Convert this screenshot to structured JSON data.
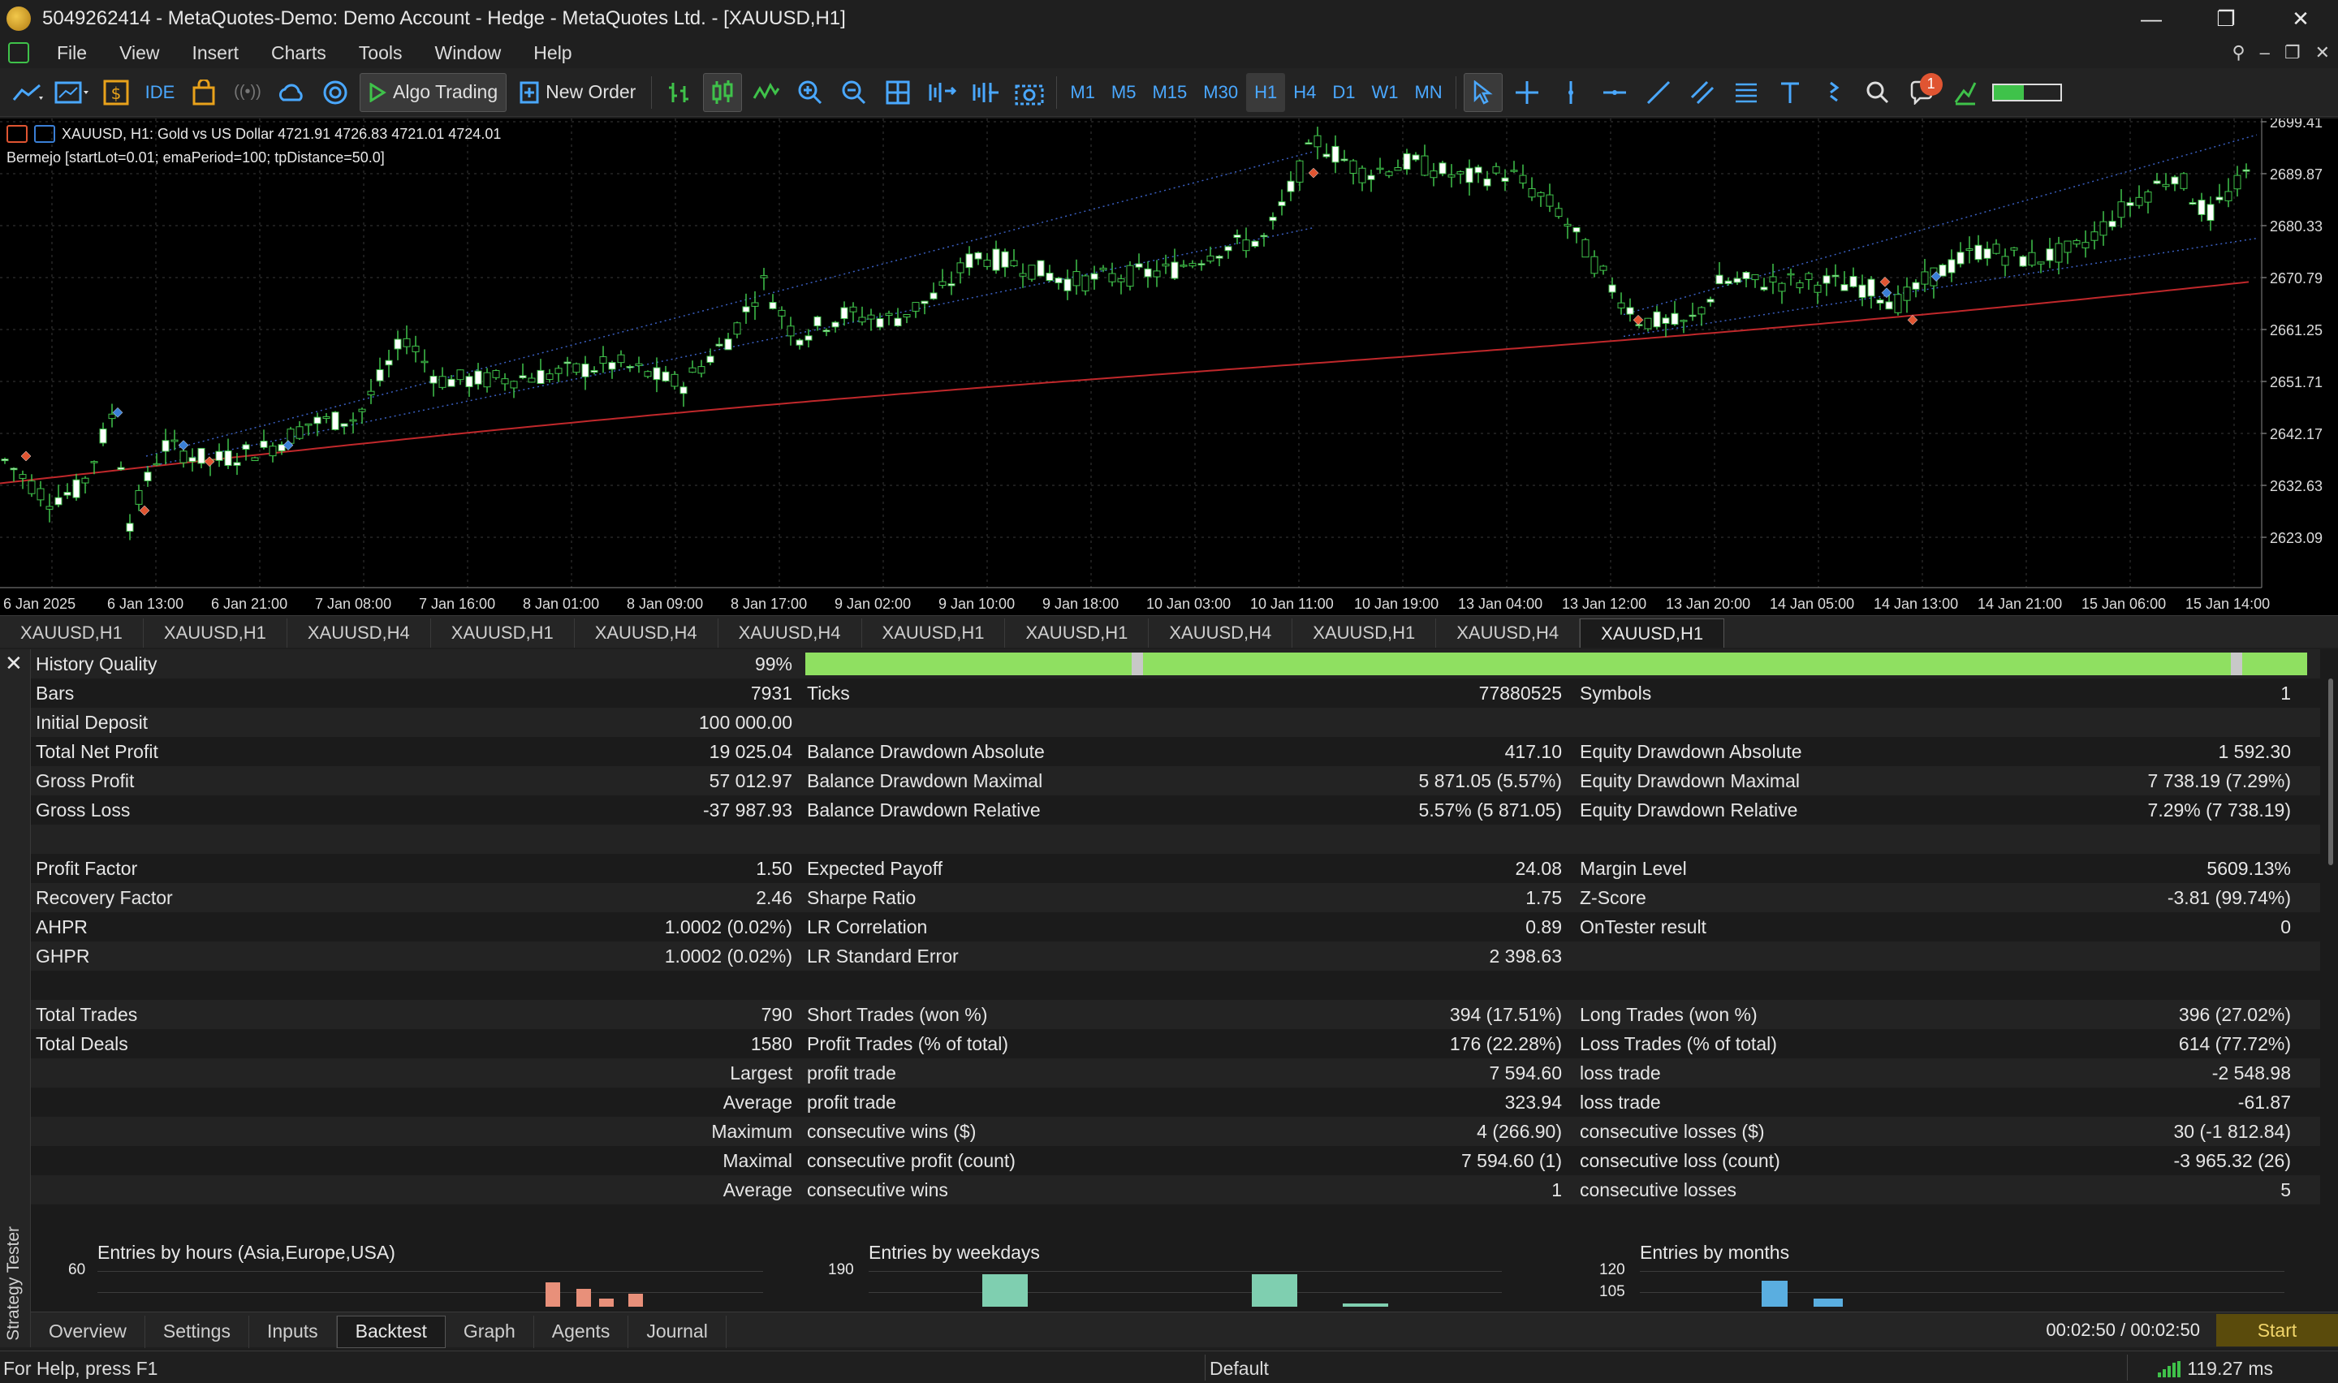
{
  "window": {
    "title": "5049262414 - MetaQuotes-Demo: Demo Account - Hedge - MetaQuotes Ltd. - [XAUUSD,H1]",
    "controls": [
      "—",
      "❐",
      "✕"
    ]
  },
  "menu": {
    "items": [
      "File",
      "View",
      "Insert",
      "Charts",
      "Tools",
      "Window",
      "Help"
    ]
  },
  "toolbar": {
    "ide_label": "IDE",
    "algo_trading_label": "Algo Trading",
    "new_order_label": "New Order",
    "timeframes": [
      "M1",
      "M5",
      "M15",
      "M30",
      "H1",
      "H4",
      "D1",
      "W1",
      "MN"
    ],
    "selected_timeframe": "H1",
    "notification_count": "1",
    "level_fill": 0.45
  },
  "chart": {
    "symbol_info": "XAUUSD, H1:  Gold vs US Dollar  4721.91 4726.83 4721.01 4724.01",
    "expert_info": "Bermejo [startLot=0.01; emaPeriod=100; tpDistance=50.0]",
    "price_ticks": [
      "2699.41",
      "2689.87",
      "2680.33",
      "2670.79",
      "2661.25",
      "2651.71",
      "2642.17",
      "2632.63",
      "2623.09"
    ],
    "time_ticks": [
      "6 Jan 2025",
      "6 Jan 13:00",
      "6 Jan 21:00",
      "7 Jan 08:00",
      "7 Jan 16:00",
      "8 Jan 01:00",
      "8 Jan 09:00",
      "8 Jan 17:00",
      "9 Jan 02:00",
      "9 Jan 10:00",
      "9 Jan 18:00",
      "10 Jan 03:00",
      "10 Jan 11:00",
      "10 Jan 19:00",
      "13 Jan 04:00",
      "13 Jan 12:00",
      "13 Jan 20:00",
      "14 Jan 05:00",
      "14 Jan 13:00",
      "14 Jan 21:00",
      "15 Jan 06:00",
      "15 Jan 14:00"
    ],
    "colors": {
      "background": "#000000",
      "grid": "#3a3a3a",
      "ema": "#c0282b",
      "bull": "#ffffff",
      "bear": "#000000",
      "wick": "#3fc24a",
      "buy_marker": "#3a7fd6",
      "sell_marker": "#e05532"
    }
  },
  "symbol_tabs": [
    "XAUUSD,H1",
    "XAUUSD,H1",
    "XAUUSD,H4",
    "XAUUSD,H1",
    "XAUUSD,H4",
    "XAUUSD,H4",
    "XAUUSD,H1",
    "XAUUSD,H1",
    "XAUUSD,H4",
    "XAUUSD,H1",
    "XAUUSD,H4",
    "XAUUSD,H1"
  ],
  "active_symbol_tab": 11,
  "tester": {
    "sidebar_label": "Strategy Tester",
    "history_quality": {
      "label": "History Quality",
      "value": "99%"
    },
    "rows": [
      {
        "c1": [
          "Bars",
          "7931"
        ],
        "c2": [
          "Ticks",
          "77880525"
        ],
        "c3": [
          "Symbols",
          "1"
        ]
      },
      {
        "c1": [
          "Initial Deposit",
          "100 000.00"
        ],
        "c2": [
          "",
          ""
        ],
        "c3": [
          "",
          ""
        ]
      },
      {
        "c1": [
          "Total Net Profit",
          "19 025.04"
        ],
        "c2": [
          "Balance Drawdown Absolute",
          "417.10"
        ],
        "c3": [
          "Equity Drawdown Absolute",
          "1 592.30"
        ]
      },
      {
        "c1": [
          "Gross Profit",
          "57 012.97"
        ],
        "c2": [
          "Balance Drawdown Maximal",
          "5 871.05 (5.57%)"
        ],
        "c3": [
          "Equity Drawdown Maximal",
          "7 738.19 (7.29%)"
        ]
      },
      {
        "c1": [
          "Gross Loss",
          "-37 987.93"
        ],
        "c2": [
          "Balance Drawdown Relative",
          "5.57% (5 871.05)"
        ],
        "c3": [
          "Equity Drawdown Relative",
          "7.29% (7 738.19)"
        ]
      },
      {
        "c1": [
          "",
          ""
        ],
        "c2": [
          "",
          ""
        ],
        "c3": [
          "",
          ""
        ]
      },
      {
        "c1": [
          "Profit Factor",
          "1.50"
        ],
        "c2": [
          "Expected Payoff",
          "24.08"
        ],
        "c3": [
          "Margin Level",
          "5609.13%"
        ]
      },
      {
        "c1": [
          "Recovery Factor",
          "2.46"
        ],
        "c2": [
          "Sharpe Ratio",
          "1.75"
        ],
        "c3": [
          "Z-Score",
          "-3.81 (99.74%)"
        ]
      },
      {
        "c1": [
          "AHPR",
          "1.0002 (0.02%)"
        ],
        "c2": [
          "LR Correlation",
          "0.89"
        ],
        "c3": [
          "OnTester result",
          "0"
        ]
      },
      {
        "c1": [
          "GHPR",
          "1.0002 (0.02%)"
        ],
        "c2": [
          "LR Standard Error",
          "2 398.63"
        ],
        "c3": [
          "",
          ""
        ]
      },
      {
        "c1": [
          "",
          ""
        ],
        "c2": [
          "",
          ""
        ],
        "c3": [
          "",
          ""
        ]
      },
      {
        "c1": [
          "Total Trades",
          "790"
        ],
        "c2": [
          "Short Trades (won %)",
          "394 (17.51%)"
        ],
        "c3": [
          "Long Trades (won %)",
          "396 (27.02%)"
        ]
      },
      {
        "c1": [
          "Total Deals",
          "1580"
        ],
        "c2": [
          "Profit Trades (% of total)",
          "176 (22.28%)"
        ],
        "c3": [
          "Loss Trades (% of total)",
          "614 (77.72%)"
        ]
      },
      {
        "c1": [
          "",
          "Largest"
        ],
        "c2": [
          "profit trade",
          "7 594.60"
        ],
        "c3": [
          "loss trade",
          "-2 548.98"
        ]
      },
      {
        "c1": [
          "",
          "Average"
        ],
        "c2": [
          "profit trade",
          "323.94"
        ],
        "c3": [
          "loss trade",
          "-61.87"
        ]
      },
      {
        "c1": [
          "",
          "Maximum"
        ],
        "c2": [
          "consecutive wins ($)",
          "4 (266.90)"
        ],
        "c3": [
          "consecutive losses ($)",
          "30 (-1 812.84)"
        ]
      },
      {
        "c1": [
          "",
          "Maximal"
        ],
        "c2": [
          "consecutive profit (count)",
          "7 594.60 (1)"
        ],
        "c3": [
          "consecutive loss (count)",
          "-3 965.32 (26)"
        ]
      },
      {
        "c1": [
          "",
          "Average"
        ],
        "c2": [
          "consecutive wins",
          "1"
        ],
        "c3": [
          "consecutive losses",
          "5"
        ]
      }
    ],
    "mini_charts": [
      {
        "title": "Entries by hours (Asia,Europe,USA)",
        "yticks": [
          "60"
        ],
        "color": "#e8907a"
      },
      {
        "title": "Entries by weekdays",
        "yticks": [
          "190"
        ],
        "color": "#7fcfb0"
      },
      {
        "title": "Entries by months",
        "yticks": [
          "120",
          "105"
        ],
        "color": "#5aaee0"
      }
    ],
    "tabs": [
      "Overview",
      "Settings",
      "Inputs",
      "Backtest",
      "Graph",
      "Agents",
      "Journal"
    ],
    "active_tab": "Backtest",
    "timer": "00:02:50 / 00:02:50",
    "start_label": "Start"
  },
  "statusbar": {
    "help": "For Help, press F1",
    "profile": "Default",
    "ping": "119.27 ms"
  }
}
